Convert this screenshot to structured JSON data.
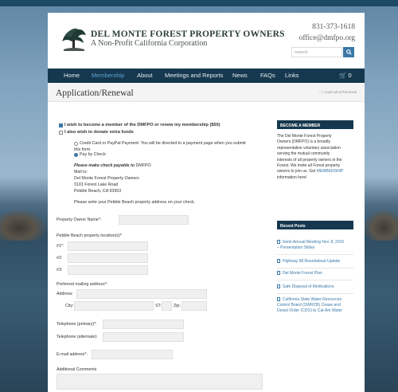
{
  "header": {
    "org_name": "DEL MONTE FOREST PROPERTY OWNERS",
    "org_sub": "A Non-Profit California Corporation",
    "phone": "831-373-1618",
    "email": "office@dmfpo.org",
    "search_placeholder": "search"
  },
  "nav": {
    "items": [
      "Home",
      "Membership",
      "About",
      "Meetings and Reports",
      "News",
      "FAQs",
      "Links"
    ],
    "active": "Membership",
    "cart_count": "0"
  },
  "page": {
    "title": "Application/Renewal",
    "breadcrumb": "/ Application/Renewal"
  },
  "form": {
    "join_label": "I wish to become a member of the DMFPO or renew my membership ($50)",
    "donate_label": "I also wish to donate extra funds",
    "payment_cc_line1": "Credit Card or PayPal Payment: You will be directed to a payment page when you submit",
    "payment_cc_line2": "this form.",
    "payment_check": "Pay by Check:",
    "check_note_bold": "Please make check payable to",
    "check_note_org": "DMFPO",
    "mail_to": "Mail to:",
    "mail_name": "Del Monte Forest Property Owners",
    "mail_street": "3101 Forest Lake Road",
    "mail_city": "Pebble Beach, CA 93953",
    "address_note": "Please write your Pebble Beach property address on your check.",
    "owner_label": "Property Owner Name*:",
    "locations_label": "Pebble Beach property location(s)*",
    "loc1": "#1*:",
    "loc2": "#2:",
    "loc3": "#3:",
    "mailing_label": "Preferred mailing address*:",
    "address_label": "Address:",
    "city_label": "City:",
    "state_label": "ST:",
    "zip_label": "Zip:",
    "tel_primary": "Telephone (primary)*:",
    "tel_alt": "Telephone (alternate):",
    "email_label": "E-mail address*:",
    "comments_label": "Additional Comments"
  },
  "sidebar": {
    "become_head": "BECOME A MEMBER",
    "become_lines": [
      "The Del Monte Forest Property",
      "Owners (DMFPO) is a broadly",
      "representative voluntary association",
      "serving the mutual community",
      "interests of all property owners in the",
      "Forest. We invite all Forest property"
    ],
    "become_line7_pre": "owners to join us. Get",
    "become_link": "MEMBERSHIP",
    "become_line8": "information here!",
    "recent_head": "Recent Posts",
    "posts": [
      "Semi-Annual Meeting Nov. 8, 2015",
      "– Presentation Slides",
      "Highway 68 Roundabout Update",
      "Del Monte Forest Plan",
      "Safe Disposal of Medications",
      "California State Water Resources",
      "Control Board (SWRCB) Cease and",
      "Desist Order (CDO) to Cal-Am Water"
    ]
  },
  "colors": {
    "nav_bg": "#16384e",
    "accent": "#3a78a8",
    "active_nav": "#5fa4d6"
  }
}
